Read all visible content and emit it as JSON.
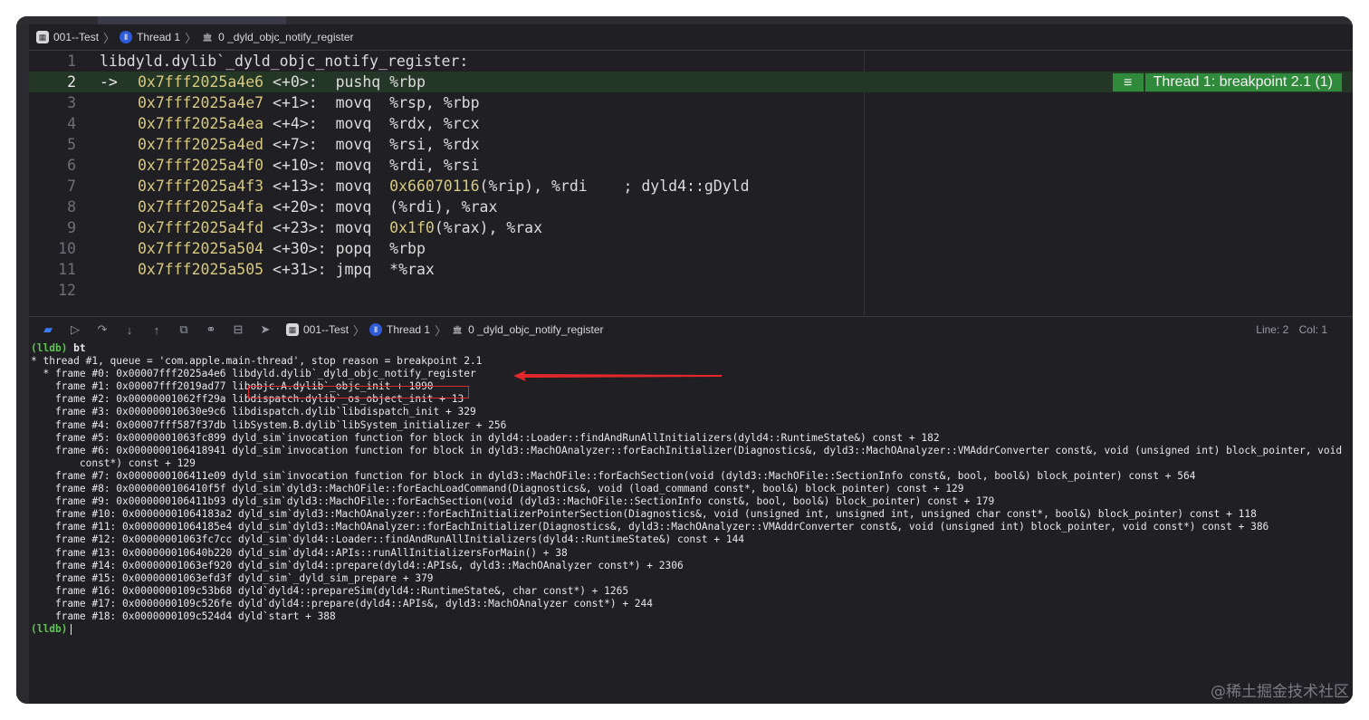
{
  "breadcrumb": {
    "target": "001--Test",
    "thread": "Thread 1",
    "function": "0 _dyld_objc_notify_register"
  },
  "editor": {
    "lines": [
      {
        "n": "1",
        "arrow": "",
        "addr": "",
        "offset": "",
        "op": "",
        "args": "",
        "comment": "",
        "raw": "libdyld.dylib`_dyld_objc_notify_register:"
      },
      {
        "n": "2",
        "arrow": "->",
        "addr": "0x7fff2025a4e6",
        "offset": " <+0>:  ",
        "op": "pushq ",
        "args": "%rbp",
        "comment": ""
      },
      {
        "n": "3",
        "arrow": "",
        "addr": "0x7fff2025a4e7",
        "offset": " <+1>:  ",
        "op": "movq  ",
        "args": "%rsp, %rbp",
        "comment": ""
      },
      {
        "n": "4",
        "arrow": "",
        "addr": "0x7fff2025a4ea",
        "offset": " <+4>:  ",
        "op": "movq  ",
        "args": "%rdx, %rcx",
        "comment": ""
      },
      {
        "n": "5",
        "arrow": "",
        "addr": "0x7fff2025a4ed",
        "offset": " <+7>:  ",
        "op": "movq  ",
        "args": "%rsi, %rdx",
        "comment": ""
      },
      {
        "n": "6",
        "arrow": "",
        "addr": "0x7fff2025a4f0",
        "offset": " <+10>: ",
        "op": "movq  ",
        "args": "%rdi, %rsi",
        "comment": ""
      },
      {
        "n": "7",
        "arrow": "",
        "addr": "0x7fff2025a4f3",
        "offset": " <+13>: ",
        "op": "movq  ",
        "argnum": "0x66070116",
        "args": "(%rip), %rdi",
        "comment": "    ; dyld4::gDyld"
      },
      {
        "n": "8",
        "arrow": "",
        "addr": "0x7fff2025a4fa",
        "offset": " <+20>: ",
        "op": "movq  ",
        "args": "(%rdi), %rax",
        "comment": ""
      },
      {
        "n": "9",
        "arrow": "",
        "addr": "0x7fff2025a4fd",
        "offset": " <+23>: ",
        "op": "movq  ",
        "argnum": "0x1f0",
        "args": "(%rax), %rax",
        "comment": ""
      },
      {
        "n": "10",
        "arrow": "",
        "addr": "0x7fff2025a504",
        "offset": " <+30>: ",
        "op": "popq  ",
        "args": "%rbp",
        "comment": ""
      },
      {
        "n": "11",
        "arrow": "",
        "addr": "0x7fff2025a505",
        "offset": " <+31>: ",
        "op": "jmpq  ",
        "args": "*%rax",
        "comment": ""
      },
      {
        "n": "12",
        "arrow": "",
        "addr": "",
        "offset": "",
        "op": "",
        "args": "",
        "comment": ""
      }
    ],
    "highlight_line": 2,
    "breakpoint_label": "Thread 1: breakpoint 2.1 (1)"
  },
  "debugbar": {
    "target": "001--Test",
    "thread": "Thread 1",
    "function": "0 _dyld_objc_notify_register",
    "line": "Line: 2",
    "col": "Col: 1"
  },
  "console": {
    "prompt": "(lldb)",
    "command": "bt",
    "lines": [
      "* thread #1, queue = 'com.apple.main-thread', stop reason = breakpoint 2.1",
      "  * frame #0: 0x00007fff2025a4e6 libdyld.dylib`_dyld_objc_notify_register",
      "    frame #1: 0x00007fff2019ad77 libobjc.A.dylib`_objc_init + 1090",
      "    frame #2: 0x00000001062ff29a libdispatch.dylib`_os_object_init + 13",
      "    frame #3: 0x000000010630e9c6 libdispatch.dylib`libdispatch_init + 329",
      "    frame #4: 0x00007fff587f37db libSystem.B.dylib`libSystem_initializer + 256",
      "    frame #5: 0x00000001063fc899 dyld_sim`invocation function for block in dyld4::Loader::findAndRunAllInitializers(dyld4::RuntimeState&) const + 182",
      "    frame #6: 0x0000000106418941 dyld_sim`invocation function for block in dyld3::MachOAnalyzer::forEachInitializer(Diagnostics&, dyld3::MachOAnalyzer::VMAddrConverter const&, void (unsigned int) block_pointer, void",
      "        const*) const + 129",
      "    frame #7: 0x0000000106411e09 dyld_sim`invocation function for block in dyld3::MachOFile::forEachSection(void (dyld3::MachOFile::SectionInfo const&, bool, bool&) block_pointer) const + 564",
      "    frame #8: 0x0000000106410f5f dyld_sim`dyld3::MachOFile::forEachLoadCommand(Diagnostics&, void (load_command const*, bool&) block_pointer) const + 129",
      "    frame #9: 0x0000000106411b93 dyld_sim`dyld3::MachOFile::forEachSection(void (dyld3::MachOFile::SectionInfo const&, bool, bool&) block_pointer) const + 179",
      "    frame #10: 0x00000001064183a2 dyld_sim`dyld3::MachOAnalyzer::forEachInitializerPointerSection(Diagnostics&, void (unsigned int, unsigned int, unsigned char const*, bool&) block_pointer) const + 118",
      "    frame #11: 0x00000001064185e4 dyld_sim`dyld3::MachOAnalyzer::forEachInitializer(Diagnostics&, dyld3::MachOAnalyzer::VMAddrConverter const&, void (unsigned int) block_pointer, void const*) const + 386",
      "    frame #12: 0x00000001063fc7cc dyld_sim`dyld4::Loader::findAndRunAllInitializers(dyld4::RuntimeState&) const + 144",
      "    frame #13: 0x000000010640b220 dyld_sim`dyld4::APIs::runAllInitializersForMain() + 38",
      "    frame #14: 0x00000001063ef920 dyld_sim`dyld4::prepare(dyld4::APIs&, dyld3::MachOAnalyzer const*) + 2306",
      "    frame #15: 0x00000001063efd3f dyld_sim`_dyld_sim_prepare + 379",
      "    frame #16: 0x0000000109c53b68 dyld`dyld4::prepareSim(dyld4::RuntimeState&, char const*) + 1265",
      "    frame #17: 0x0000000109c526fe dyld`dyld4::prepare(dyld4::APIs&, dyld3::MachOAnalyzer const*) + 244",
      "    frame #18: 0x0000000109c524d4 dyld`start + 388"
    ],
    "final_prompt": "(lldb)"
  },
  "watermark": "@稀土掘金技术社区",
  "colors": {
    "background": "#1f1f24",
    "highlight": "#243626",
    "breakpoint": "#2f8a3b",
    "address": "#d9c97c",
    "prompt": "#61c554",
    "annotation": "#e2282a"
  }
}
